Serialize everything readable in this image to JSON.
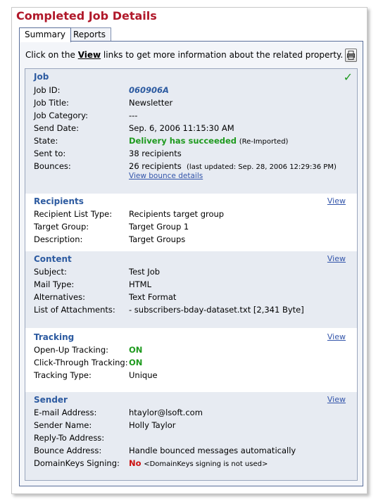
{
  "page": {
    "title": "Completed Job Details"
  },
  "tabs": [
    {
      "label": "Summary"
    },
    {
      "label": "Reports"
    }
  ],
  "intro": {
    "before": "Click on the ",
    "link_word": "View",
    "after": " links to get more information about the related property."
  },
  "icons": {
    "print": "print-icon",
    "status_check": "check-icon"
  },
  "colors": {
    "title": "#b0182a",
    "section_title": "#2c5aa0",
    "success": "#1f9a1f",
    "negative": "#cc1111",
    "link": "#3355aa"
  },
  "job": {
    "title": "Job",
    "check_glyph": "✓",
    "job_id_label": "Job ID:",
    "job_id": "060906A",
    "job_title_label": "Job Title:",
    "job_title": "Newsletter",
    "category_label": "Job Category:",
    "category": "---",
    "send_date_label": "Send Date:",
    "send_date": "Sep. 6, 2006 11:15:30 AM",
    "state_label": "State:",
    "state": "Delivery has succeeded",
    "state_note": "(Re-Imported)",
    "sent_to_label": "Sent to:",
    "sent_to": "38 recipients",
    "bounces_label": "Bounces:",
    "bounces": "26 recipients",
    "bounces_note": "(last updated: Sep. 28, 2006 12:29:36 PM)",
    "bounce_link": "View bounce details"
  },
  "recipients": {
    "title": "Recipients",
    "view": "View",
    "list_type_label": "Recipient List Type:",
    "list_type": "Recipients target group",
    "target_group_label": "Target Group:",
    "target_group": "Target Group 1",
    "description_label": "Description:",
    "description": "Target Groups"
  },
  "content": {
    "title": "Content",
    "view": "View",
    "subject_label": "Subject:",
    "subject": "Test Job",
    "mail_type_label": "Mail Type:",
    "mail_type": "HTML",
    "alternatives_label": "Alternatives:",
    "alternatives": "Text Format",
    "attachments_label": "List of Attachments:",
    "attachments": "- subscribers-bday-dataset.txt [2,341 Byte]"
  },
  "tracking": {
    "title": "Tracking",
    "view": "View",
    "open_up_label": "Open-Up Tracking:",
    "open_up": "ON",
    "click_through_label": "Click-Through Tracking:",
    "click_through": "ON",
    "type_label": "Tracking Type:",
    "type": "Unique"
  },
  "sender": {
    "title": "Sender",
    "view": "View",
    "email_label": "E-mail Address:",
    "email": "htaylor@lsoft.com",
    "name_label": "Sender Name:",
    "name": "Holly Taylor",
    "reply_to_label": "Reply-To Address:",
    "reply_to": "",
    "bounce_label": "Bounce Address:",
    "bounce": "Handle bounced messages automatically",
    "domainkeys_label": "DomainKeys Signing:",
    "domainkeys": "No",
    "domainkeys_note": "<DomainKeys signing is not used>"
  }
}
